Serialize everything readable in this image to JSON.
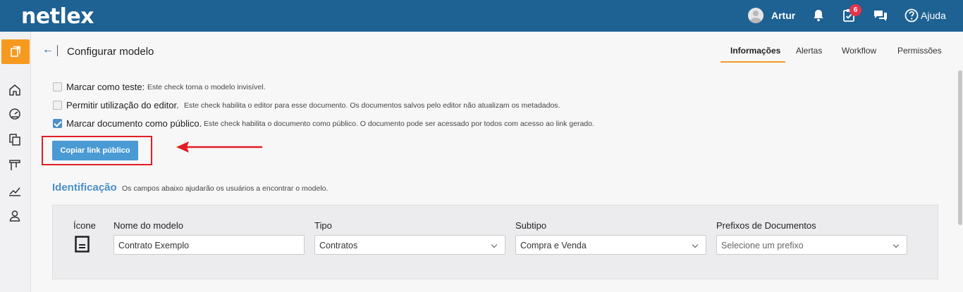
{
  "app": {
    "logo": "netlex"
  },
  "topbar": {
    "user_name": "Artur",
    "tasks_badge": "6",
    "help_label": "Ajuda",
    "icons": [
      "avatar",
      "bell-icon",
      "tasks-icon",
      "chat-icon",
      "help-icon"
    ]
  },
  "leftrail": {
    "icons": [
      "new-document-icon",
      "home-icon",
      "dashboard-icon",
      "documents-icon",
      "board-icon",
      "analytics-icon",
      "user-icon"
    ],
    "accent_color": "#f59a1f"
  },
  "header": {
    "back_icon": "back-arrow-icon",
    "title": "Configurar modelo",
    "tabs": [
      {
        "label": "Informações",
        "active": true
      },
      {
        "label": "Alertas",
        "active": false
      },
      {
        "label": "Workflow",
        "active": false
      },
      {
        "label": "Permissões",
        "active": false
      }
    ]
  },
  "checks": [
    {
      "label": "Marcar como teste:",
      "desc": "Este check torna o modelo invisível.",
      "checked": false
    },
    {
      "label": "Permitir utilização do editor.",
      "desc": "Este check habilita o editor para esse documento. Os documentos salvos pelo editor não atualizam os metadados.",
      "checked": false
    },
    {
      "label": "Marcar documento como público.",
      "desc": "Este check habilita o documento como público. O documento pode ser acessado por todos com acesso ao link gerado.",
      "checked": true
    }
  ],
  "copy_button": {
    "label": "Copiar link público",
    "annotation_color": "#e21d24"
  },
  "identificacao": {
    "title": "Identificação",
    "desc": "Os campos abaixo ajudarão os usuários a encontrar o modelo.",
    "icon_label": "Ícone",
    "fields": {
      "nome": {
        "label": "Nome do modelo",
        "value": "Contrato Exemplo"
      },
      "tipo": {
        "label": "Tipo",
        "value": "Contratos"
      },
      "subtipo": {
        "label": "Subtipo",
        "value": "Compra e Venda"
      },
      "prefixos": {
        "label": "Prefixos de Documentos",
        "placeholder": "Selecione um prefixo"
      }
    }
  },
  "colors": {
    "topbar": "#1e6193",
    "primary_button": "#4a9ad4",
    "section_title": "#4a8fc8"
  }
}
